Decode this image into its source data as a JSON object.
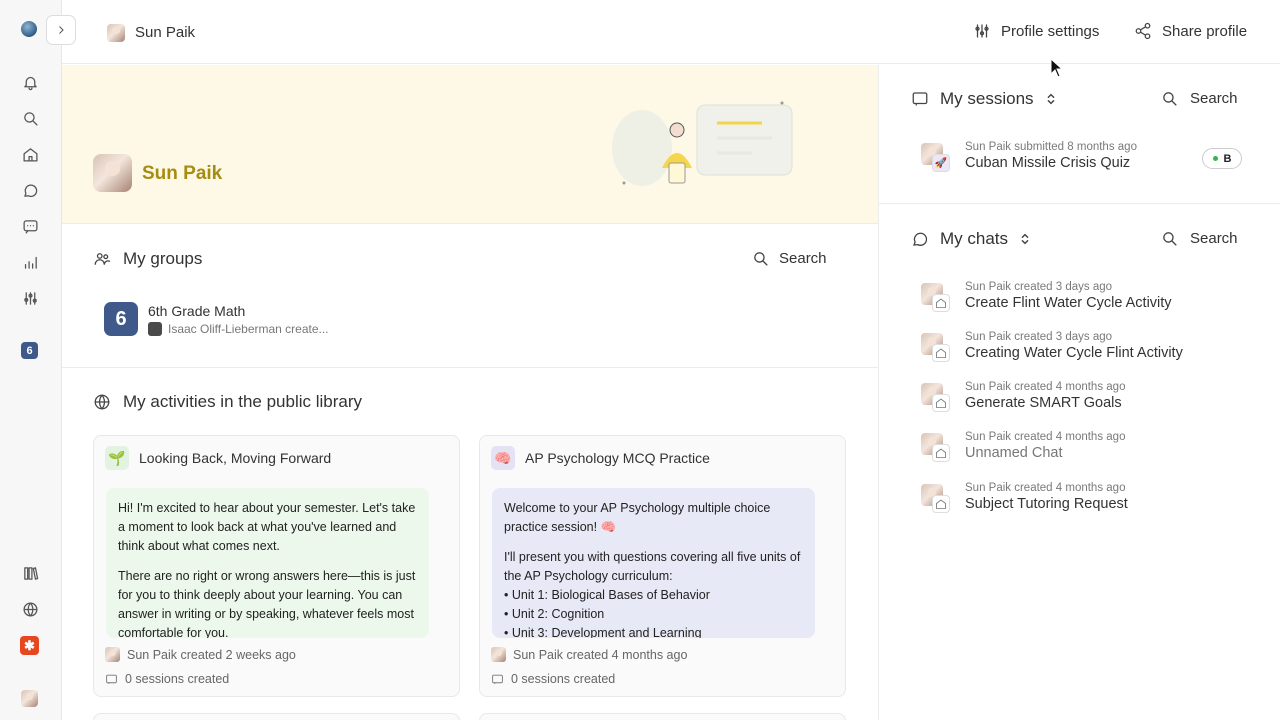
{
  "user": {
    "name": "Sun Paik"
  },
  "topbar": {
    "profile_settings": "Profile settings",
    "share_profile": "Share profile"
  },
  "rail": {
    "icons": [
      "bell-icon",
      "search-icon",
      "home-icon",
      "chat-icon",
      "feedback-icon",
      "analytics-icon",
      "sliders-icon",
      "group-6-icon",
      "library-icon",
      "globe-icon",
      "app-icon"
    ],
    "group_badge": "6",
    "app_badge": "✱"
  },
  "groups": {
    "title": "My groups",
    "search": "Search",
    "items": [
      {
        "badge": "6",
        "name": "6th Grade Math",
        "sub": "Isaac Oliff-Lieberman create..."
      }
    ]
  },
  "library": {
    "title": "My activities in the public library",
    "cards": [
      {
        "emoji": "🌱",
        "title": "Looking Back, Moving Forward",
        "p1": "Hi! I'm excited to hear about your semester. Let's take a moment to look back at what you've learned and think about what comes next.",
        "p2": "There are no right or wrong answers here—this is just for you to think deeply about your learning. You can answer in writing or by speaking, whatever feels most comfortable for you.",
        "created": "Sun Paik created 2 weeks ago",
        "sessions": "0 sessions created",
        "body_color": "#ecf8ec"
      },
      {
        "emoji": "🧠",
        "title": "AP Psychology MCQ Practice",
        "p1": "Welcome to your AP Psychology multiple choice practice session! 🧠",
        "p2": "I'll present you with questions covering all five units of the AP Psychology curriculum:\n• Unit 1: Biological Bases of Behavior\n• Unit 2: Cognition\n• Unit 3: Development and Learning",
        "created": "Sun Paik created 4 months ago",
        "sessions": "0 sessions created",
        "body_color": "#e8e9f6"
      }
    ]
  },
  "sessions": {
    "title": "My sessions",
    "search": "Search",
    "items": [
      {
        "meta": "Sun Paik submitted 8 months ago",
        "title": "Cuban Missile Crisis Quiz",
        "grade": "B"
      }
    ]
  },
  "chats": {
    "title": "My chats",
    "search": "Search",
    "items": [
      {
        "meta": "Sun Paik created 3 days ago",
        "title": "Create Flint Water Cycle Activity"
      },
      {
        "meta": "Sun Paik created 3 days ago",
        "title": "Creating Water Cycle Flint Activity"
      },
      {
        "meta": "Sun Paik created 4 months ago",
        "title": "Generate SMART Goals"
      },
      {
        "meta": "Sun Paik created 4 months ago",
        "title": "Unnamed Chat"
      },
      {
        "meta": "Sun Paik created 4 months ago",
        "title": "Subject Tutoring Request"
      }
    ]
  }
}
